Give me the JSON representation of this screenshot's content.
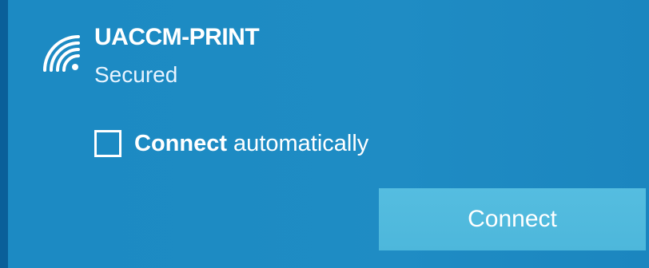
{
  "network": {
    "name": "UACCM-PRINT",
    "status": "Secured",
    "icon": "wifi-signal-icon"
  },
  "options": {
    "connect_auto_bold": "Connect",
    "connect_auto_rest": " automatically",
    "connect_auto_checked": false
  },
  "actions": {
    "connect_label": "Connect"
  },
  "colors": {
    "panel_background": "#1d8bc3",
    "button_background": "#4db7db",
    "text": "#ffffff"
  }
}
